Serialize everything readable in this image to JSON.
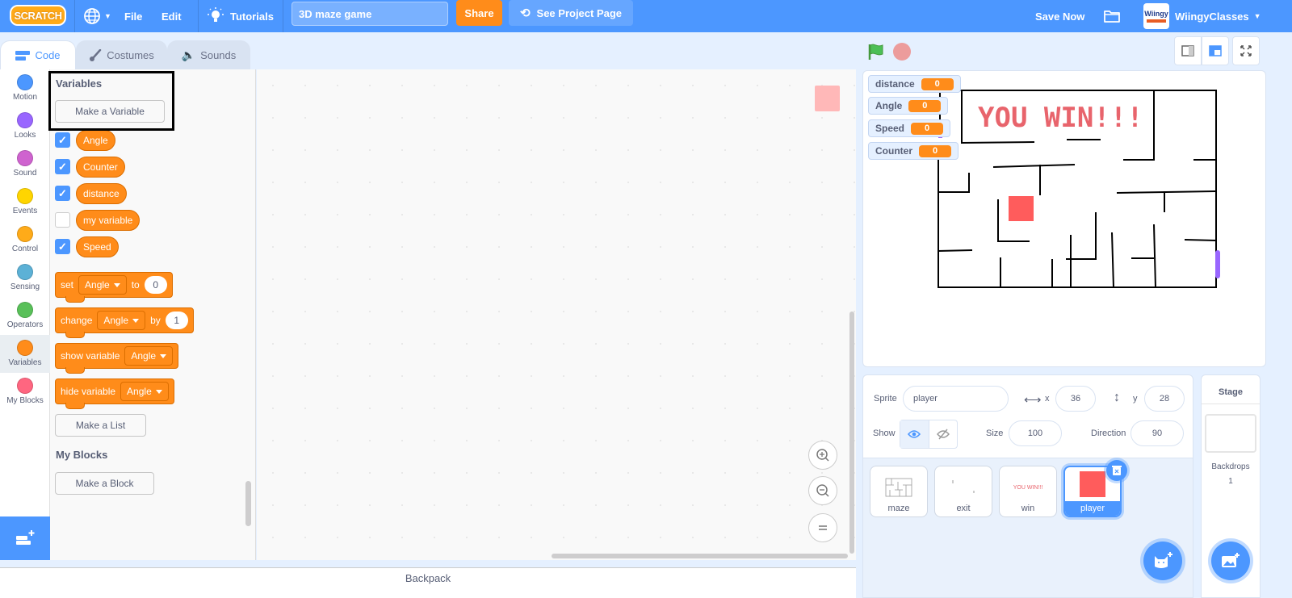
{
  "menubar": {
    "logo": "SCRATCH",
    "file": "File",
    "edit": "Edit",
    "tutorials": "Tutorials",
    "project_title": "3D maze game",
    "share": "Share",
    "see_project_page": "See Project Page",
    "save_now": "Save Now",
    "avatar_text": "Wiingy",
    "username": "WiingyClasses"
  },
  "tabs": [
    {
      "label": "Code",
      "active": true
    },
    {
      "label": "Costumes",
      "active": false
    },
    {
      "label": "Sounds",
      "active": false
    }
  ],
  "categories": [
    {
      "label": "Motion",
      "color": "#4c97ff"
    },
    {
      "label": "Looks",
      "color": "#9966ff"
    },
    {
      "label": "Sound",
      "color": "#cf63cf"
    },
    {
      "label": "Events",
      "color": "#ffd500"
    },
    {
      "label": "Control",
      "color": "#ffab19"
    },
    {
      "label": "Sensing",
      "color": "#5cb1d6"
    },
    {
      "label": "Operators",
      "color": "#59c059"
    },
    {
      "label": "Variables",
      "color": "#ff8c1a",
      "selected": true
    },
    {
      "label": "My Blocks",
      "color": "#ff6680"
    }
  ],
  "palette": {
    "variables_heading": "Variables",
    "make_variable": "Make a Variable",
    "variables": [
      {
        "name": "Angle",
        "checked": true
      },
      {
        "name": "Counter",
        "checked": true
      },
      {
        "name": "distance",
        "checked": true
      },
      {
        "name": "my variable",
        "checked": false
      },
      {
        "name": "Speed",
        "checked": true
      }
    ],
    "blocks": {
      "set": {
        "label": "set",
        "var": "Angle",
        "to": "to",
        "value": "0"
      },
      "change": {
        "label": "change",
        "var": "Angle",
        "by": "by",
        "value": "1"
      },
      "show": {
        "label": "show variable",
        "var": "Angle"
      },
      "hide": {
        "label": "hide variable",
        "var": "Angle"
      }
    },
    "make_list": "Make a List",
    "myblocks_heading": "My Blocks",
    "make_block": "Make a Block"
  },
  "workspace": {
    "backpack": "Backpack"
  },
  "stage": {
    "monitors": [
      {
        "name": "distance",
        "value": "0"
      },
      {
        "name": "Angle",
        "value": "0"
      },
      {
        "name": "Speed",
        "value": "0"
      },
      {
        "name": "Counter",
        "value": "0"
      }
    ],
    "win_text": "YOU WIN!!!"
  },
  "sprite_info": {
    "sprite_label": "Sprite",
    "sprite_name": "player",
    "x_label": "x",
    "x": "36",
    "y_label": "y",
    "y": "28",
    "show_label": "Show",
    "size_label": "Size",
    "size": "100",
    "direction_label": "Direction",
    "direction": "90"
  },
  "sprites": [
    {
      "name": "maze",
      "selected": false
    },
    {
      "name": "exit",
      "selected": false
    },
    {
      "name": "win",
      "selected": false,
      "thumb_text": "YOU WIN!!!"
    },
    {
      "name": "player",
      "selected": true
    }
  ],
  "stage_panel": {
    "title": "Stage",
    "backdrops_label": "Backdrops",
    "backdrops_count": "1"
  },
  "colors": {
    "accent": "#4c97ff",
    "variables": "#ff8c1a",
    "share": "#ff8c1a"
  }
}
